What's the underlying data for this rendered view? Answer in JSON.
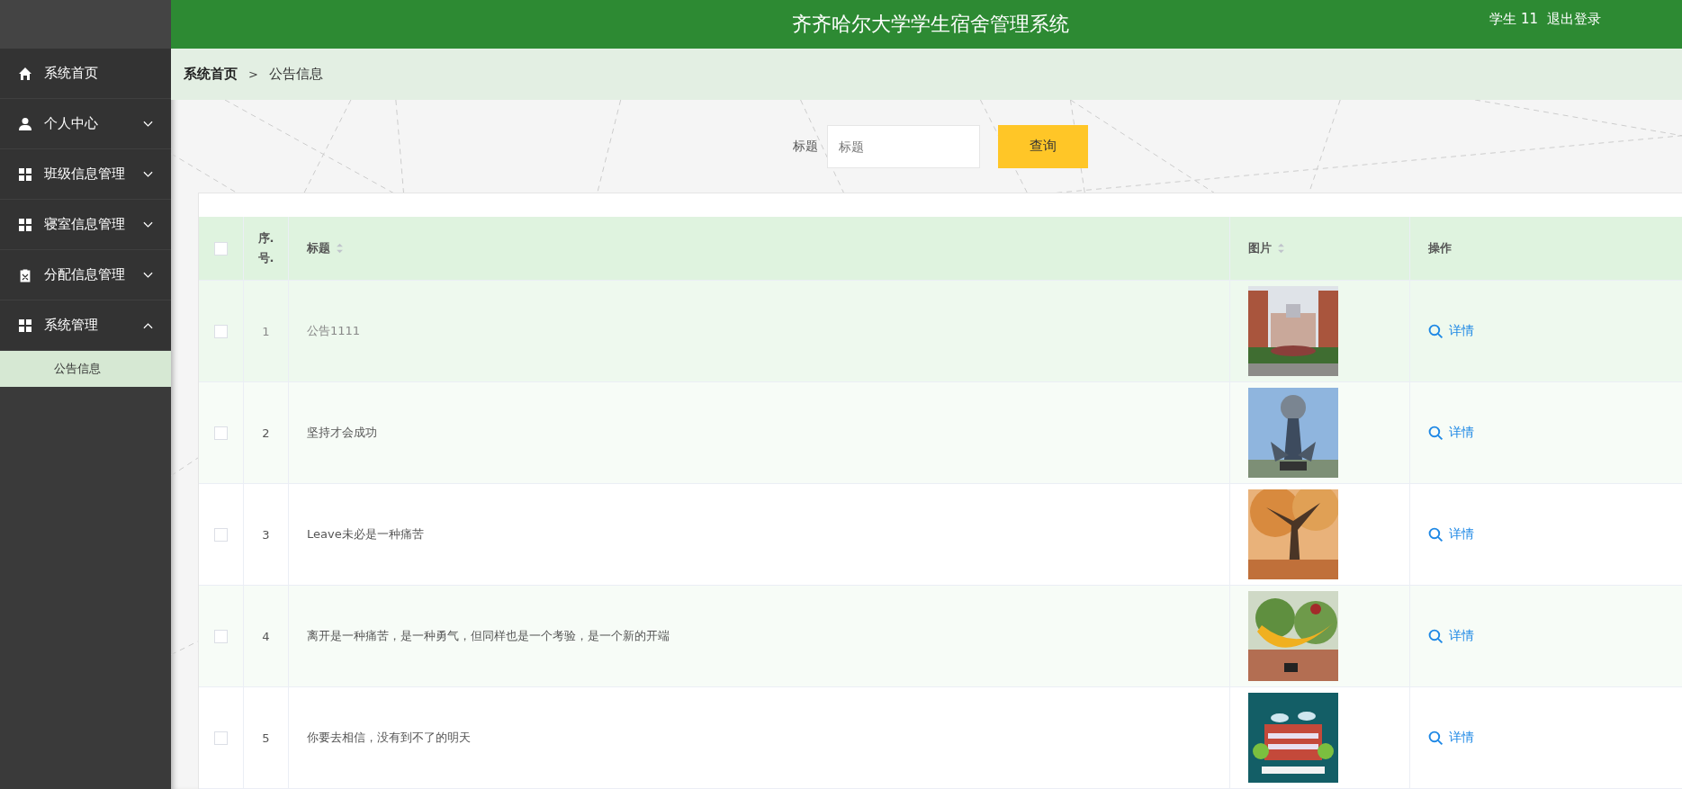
{
  "header": {
    "title": "齐齐哈尔大学学生宿舍管理系统",
    "user": "学生 11",
    "logout": "退出登录"
  },
  "sidebar": {
    "items": [
      {
        "label": "系统首页",
        "kind": "home",
        "has_children": false
      },
      {
        "label": "个人中心",
        "kind": "user",
        "expanded": false,
        "has_children": true
      },
      {
        "label": "班级信息管理",
        "kind": "grid",
        "expanded": false,
        "has_children": true
      },
      {
        "label": "寝室信息管理",
        "kind": "grid",
        "expanded": false,
        "has_children": true
      },
      {
        "label": "分配信息管理",
        "kind": "clipboard",
        "expanded": false,
        "has_children": true
      },
      {
        "label": "系统管理",
        "kind": "grid",
        "expanded": true,
        "has_children": true,
        "children": [
          {
            "label": "公告信息",
            "selected": true
          }
        ]
      }
    ]
  },
  "breadcrumb": {
    "home": "系统首页",
    "separator": ">",
    "current": "公告信息"
  },
  "search": {
    "label": "标题",
    "placeholder": "标题",
    "button": "查询"
  },
  "table": {
    "columns": [
      {
        "label": "序.号.",
        "sortable": false
      },
      {
        "label": "标题",
        "sortable": true
      },
      {
        "label": "图片",
        "sortable": true
      },
      {
        "label": "操作",
        "sortable": false
      }
    ],
    "header_checked": false,
    "rows": [
      {
        "index": "1",
        "title": "公告1111",
        "checked": false,
        "hovered": true,
        "action": "详情"
      },
      {
        "index": "2",
        "title": "坚持才会成功",
        "checked": false,
        "hovered": false,
        "action": "详情"
      },
      {
        "index": "3",
        "title": "Leave未必是一种痛苦",
        "checked": false,
        "hovered": false,
        "action": "详情"
      },
      {
        "index": "4",
        "title": "离开是一种痛苦，是一种勇气，但同样也是一个考验，是一个新的开端",
        "checked": false,
        "hovered": false,
        "action": "详情"
      },
      {
        "index": "5",
        "title": "你要去相信，没有到不了的明天",
        "checked": false,
        "hovered": false,
        "action": "详情"
      }
    ]
  }
}
